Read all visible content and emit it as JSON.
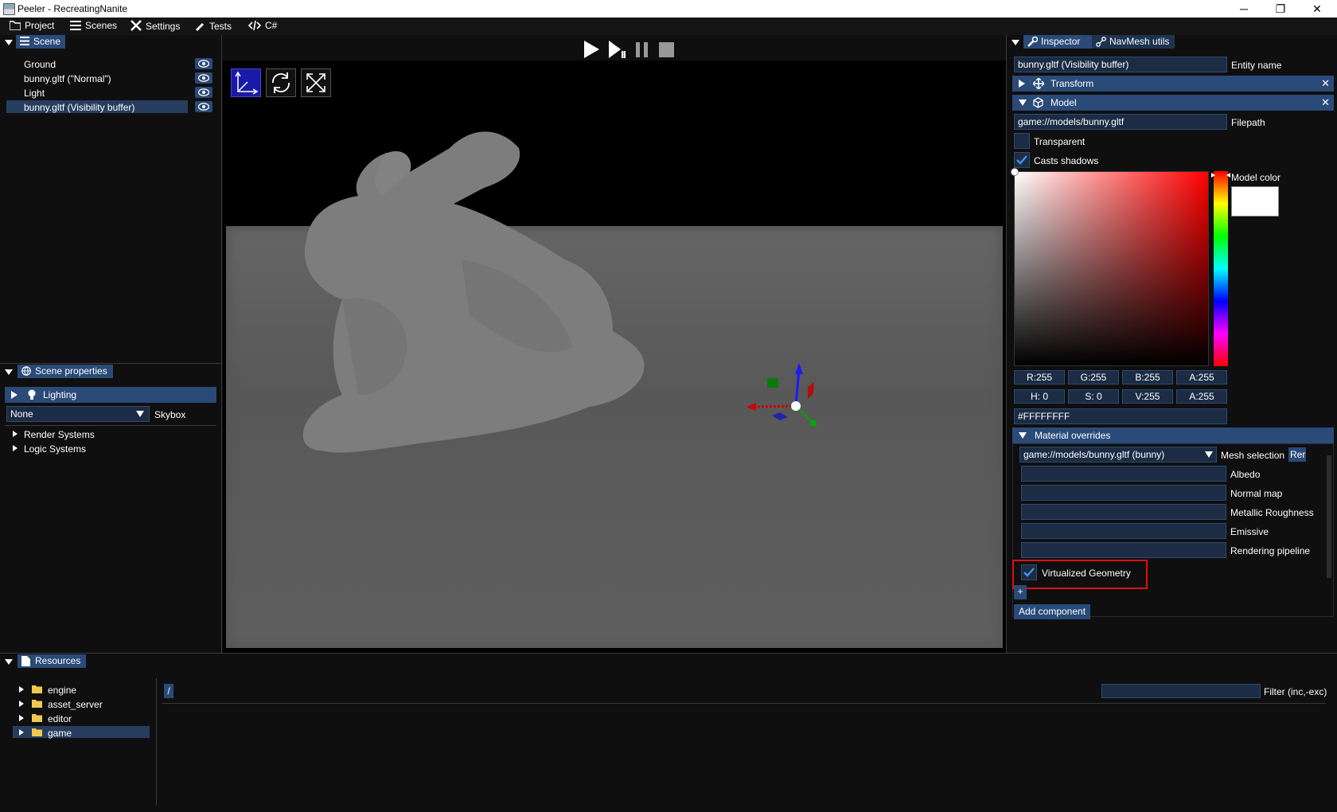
{
  "window": {
    "title": "Peeler - RecreatingNanite",
    "minimize": "─",
    "maximize": "❐",
    "close": "✕"
  },
  "menubar": {
    "items": [
      {
        "label": "Project",
        "icon": "folder-icon"
      },
      {
        "label": "Scenes",
        "icon": "list-icon"
      },
      {
        "label": "Settings",
        "icon": "tools-icon"
      },
      {
        "label": "Tests",
        "icon": "flask-icon"
      },
      {
        "label": "C#",
        "icon": "code-icon"
      }
    ]
  },
  "scene_panel": {
    "tab": "Scene",
    "entities": [
      "Ground",
      "bunny.gltf (\"Normal\")",
      "Light",
      "bunny.gltf (Visibility buffer)"
    ],
    "selected_index": 3
  },
  "scene_properties": {
    "tab": "Scene properties",
    "lighting": "Lighting",
    "skybox_value": "None",
    "skybox_label": "Skybox",
    "tree": [
      "Render Systems",
      "Logic Systems"
    ]
  },
  "viewport": {
    "playback": [
      "play",
      "step",
      "pause",
      "stop"
    ],
    "gizmo_modes": [
      "translate",
      "rotate",
      "scale"
    ],
    "active_gizmo": "translate"
  },
  "inspector": {
    "tabs": [
      "Inspector",
      "NavMesh utils"
    ],
    "entity_name_value": "bunny.gltf (Visibility buffer)",
    "entity_name_label": "Entity name",
    "transform_label": "Transform",
    "model_label": "Model",
    "filepath_value": "game://models/bunny.gltf",
    "filepath_label": "Filepath",
    "transparent_label": "Transparent",
    "transparent_checked": false,
    "casts_shadows_label": "Casts shadows",
    "casts_shadows_checked": true,
    "model_color_label": "Model color",
    "model_color_hex": "#FFFFFFFF",
    "rgba": [
      "R:255",
      "G:255",
      "B:255",
      "A:255"
    ],
    "hsva": [
      "H:  0",
      "S:  0",
      "V:255",
      "A:255"
    ],
    "material_overrides_label": "Material overrides",
    "mesh_selection_value": "game://models/bunny.gltf (bunny)",
    "mesh_selection_label": "Mesh selection",
    "remove_btn": "Rer",
    "texture_slots": [
      "Albedo",
      "Normal map",
      "Metallic Roughness",
      "Emissive",
      "Rendering pipeline"
    ],
    "virtualized_geometry_label": "Virtualized Geometry",
    "virtualized_geometry_checked": true,
    "plus_btn": "+",
    "add_component_btn": "Add component"
  },
  "resources": {
    "tab": "Resources",
    "folders": [
      "engine",
      "asset_server",
      "editor",
      "game"
    ],
    "selected_folder": "game",
    "path": "/",
    "filter_label": "Filter (inc,-exc)"
  },
  "colors": {
    "accent": "#2a4a78",
    "field_bg": "#1b2c44",
    "highlight": "#ff0000"
  }
}
